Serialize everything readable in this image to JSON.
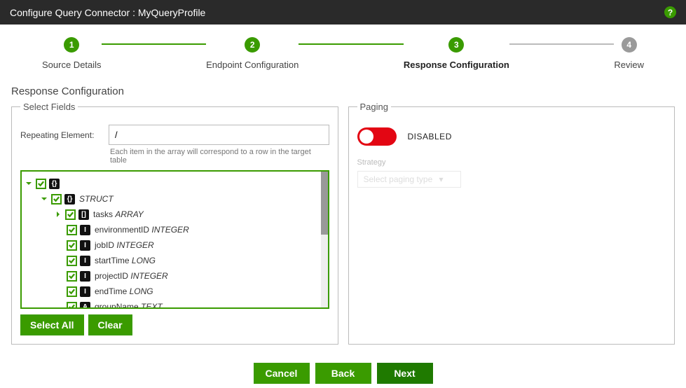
{
  "header": {
    "title": "Configure Query Connector : MyQueryProfile"
  },
  "stepper": {
    "steps": [
      {
        "num": "1",
        "label": "Source Details"
      },
      {
        "num": "2",
        "label": "Endpoint Configuration"
      },
      {
        "num": "3",
        "label": "Response Configuration"
      },
      {
        "num": "4",
        "label": "Review"
      }
    ]
  },
  "content": {
    "section_title": "Response Configuration",
    "select_fields": {
      "legend": "Select Fields",
      "repeating_label": "Repeating Element:",
      "repeating_value": "/",
      "repeating_hint": "Each item in the array will correspond to a row in the target table",
      "select_all": "Select All",
      "clear": "Clear",
      "root": {
        "badge": "{}",
        "label": ""
      },
      "struct": {
        "badge": "{}",
        "label": "STRUCT"
      },
      "fields": [
        {
          "badge": "[]",
          "name": "tasks",
          "type": "ARRAY",
          "expandable": true
        },
        {
          "badge": "I",
          "name": "environmentID",
          "type": "INTEGER"
        },
        {
          "badge": "I",
          "name": "jobID",
          "type": "INTEGER"
        },
        {
          "badge": "I",
          "name": "startTime",
          "type": "LONG"
        },
        {
          "badge": "I",
          "name": "projectID",
          "type": "INTEGER"
        },
        {
          "badge": "I",
          "name": "endTime",
          "type": "LONG"
        },
        {
          "badge": "A",
          "name": "groupName",
          "type": "TEXT"
        }
      ]
    },
    "paging": {
      "legend": "Paging",
      "toggle_state": "DISABLED",
      "strategy_label": "Strategy",
      "strategy_placeholder": "Select paging type"
    }
  },
  "footer": {
    "cancel": "Cancel",
    "back": "Back",
    "next": "Next"
  }
}
